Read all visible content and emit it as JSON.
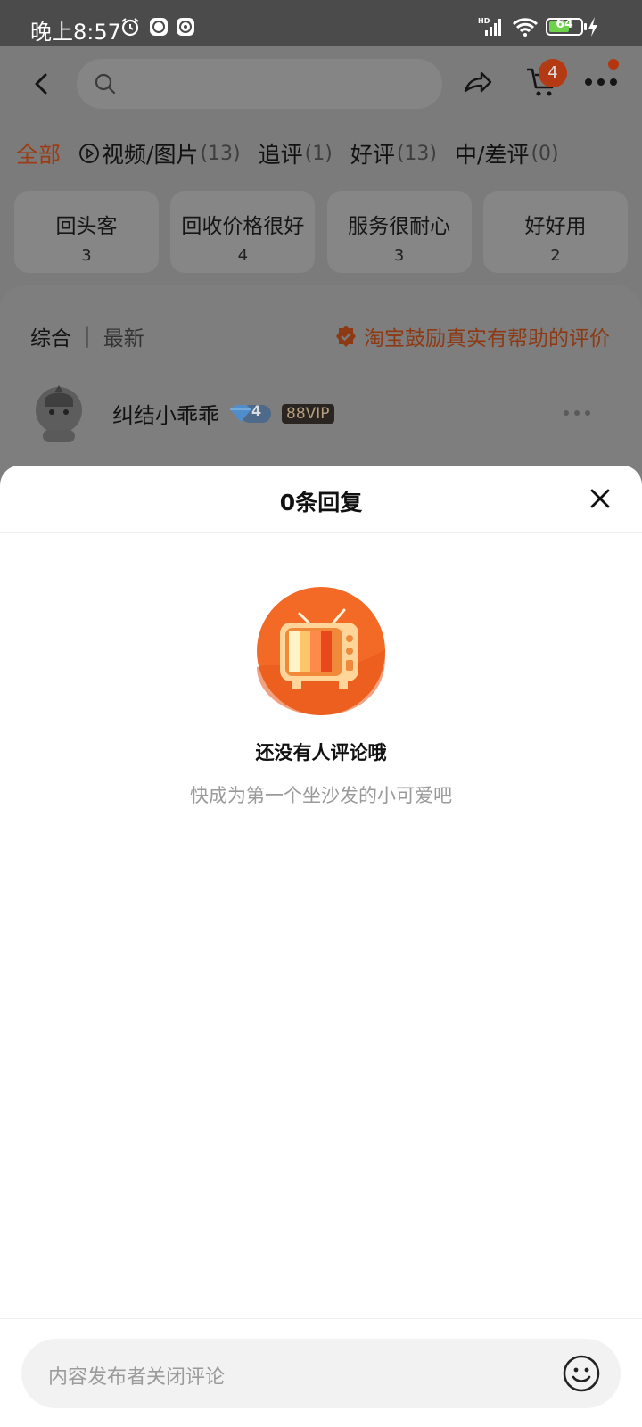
{
  "status_bar": {
    "time": "晚上8:57",
    "battery": "64",
    "battery_level": 0.64
  },
  "top_bar": {
    "cart_count": "4"
  },
  "filter_tabs": [
    {
      "label": "全部",
      "count": "",
      "active": true
    },
    {
      "label": "视频/图片",
      "count": "(13)",
      "active": false
    },
    {
      "label": "追评",
      "count": "(1)",
      "active": false
    },
    {
      "label": "好评",
      "count": "(13)",
      "active": false
    },
    {
      "label": "中/差评",
      "count": "(0)",
      "active": false
    }
  ],
  "tags": [
    {
      "label": "回头客",
      "count": "3"
    },
    {
      "label": "回收价格很好",
      "count": "4"
    },
    {
      "label": "服务很耐心",
      "count": "3"
    },
    {
      "label": "好好用",
      "count": "2"
    }
  ],
  "sort": {
    "overall": "综合",
    "separator": "|",
    "latest": "最新"
  },
  "encourage_text": "淘宝鼓励真实有帮助的评价",
  "review": {
    "reviewer_name": "纠结小乖乖",
    "level": "4",
    "vip": "88VIP"
  },
  "sheet": {
    "title": "0条回复",
    "empty_title": "还没有人评论哦",
    "empty_subtitle": "快成为第一个坐沙发的小可爱吧",
    "input_placeholder": "内容发布者关闭评论"
  },
  "colors": {
    "accent": "#ff5000",
    "overlay_bg": "#7b7b7b",
    "sheet_bg": "#ffffff",
    "input_bg": "#f2f2f2"
  }
}
